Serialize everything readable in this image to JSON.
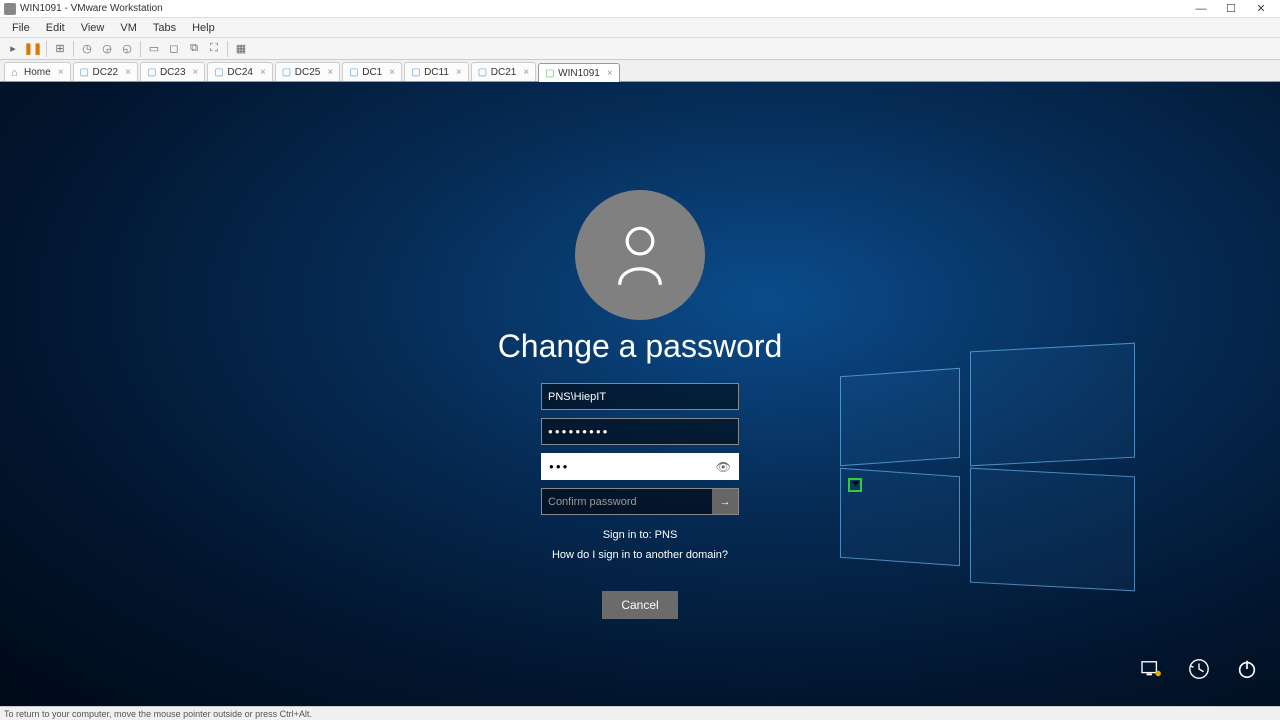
{
  "window": {
    "title": "WIN1091 - VMware Workstation",
    "controls": {
      "min": "—",
      "max": "☐",
      "close": "✕"
    }
  },
  "menu": [
    "File",
    "Edit",
    "View",
    "VM",
    "Tabs",
    "Help"
  ],
  "toolbar_icons": [
    "power-menu",
    "pause",
    "divider",
    "snapshot",
    "revert",
    "clock1",
    "clock2",
    "clock3",
    "divider",
    "fit",
    "stretch",
    "unity",
    "fullscreen",
    "divider",
    "cycle"
  ],
  "tabs": [
    {
      "label": "Home",
      "type": "home",
      "active": false
    },
    {
      "label": "DC22",
      "type": "vm",
      "active": false
    },
    {
      "label": "DC23",
      "type": "vm",
      "active": false
    },
    {
      "label": "DC24",
      "type": "vm",
      "active": false
    },
    {
      "label": "DC25",
      "type": "vm",
      "active": false
    },
    {
      "label": "DC1",
      "type": "vm",
      "active": false
    },
    {
      "label": "DC11",
      "type": "vm",
      "active": false
    },
    {
      "label": "DC21",
      "type": "vm",
      "active": false
    },
    {
      "label": "WIN1091",
      "type": "vm-green",
      "active": true
    }
  ],
  "login": {
    "heading": "Change a password",
    "username": "PNS\\HiepIT",
    "old_password_mask": "●●●●●●●●●",
    "new_password_mask": "●●●",
    "confirm_placeholder": "Confirm password",
    "signin_to": "Sign in to: PNS",
    "other_domain": "How do I sign in to another domain?",
    "cancel": "Cancel"
  },
  "statusbar": "To return to your computer, move the mouse pointer outside or press Ctrl+Alt."
}
